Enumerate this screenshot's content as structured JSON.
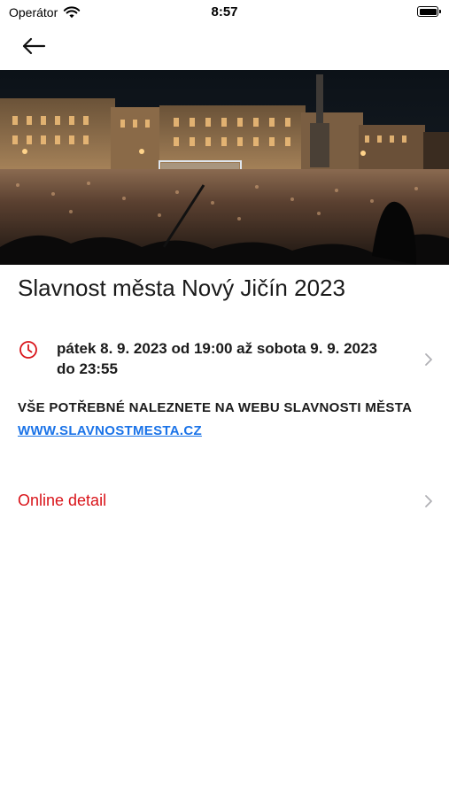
{
  "status_bar": {
    "carrier": "Operátor",
    "time": "8:57"
  },
  "nav": {
    "back_icon": "arrow-left-icon"
  },
  "event": {
    "title": "Slavnost města Nový Jičín 2023",
    "date_text": "pátek 8. 9. 2023 od 19:00 až sobota 9. 9. 2023 do 23:55",
    "info_text": "VŠE POTŘEBNÉ NALEZNETE NA WEBU SLAVNOSTI MĚSTA",
    "info_link": "WWW.SLAVNOSTMESTA.CZ",
    "online_detail_label": "Online detail"
  },
  "colors": {
    "accent": "#d9141a",
    "link": "#1a73e8",
    "chevron": "#b0b0b5"
  }
}
